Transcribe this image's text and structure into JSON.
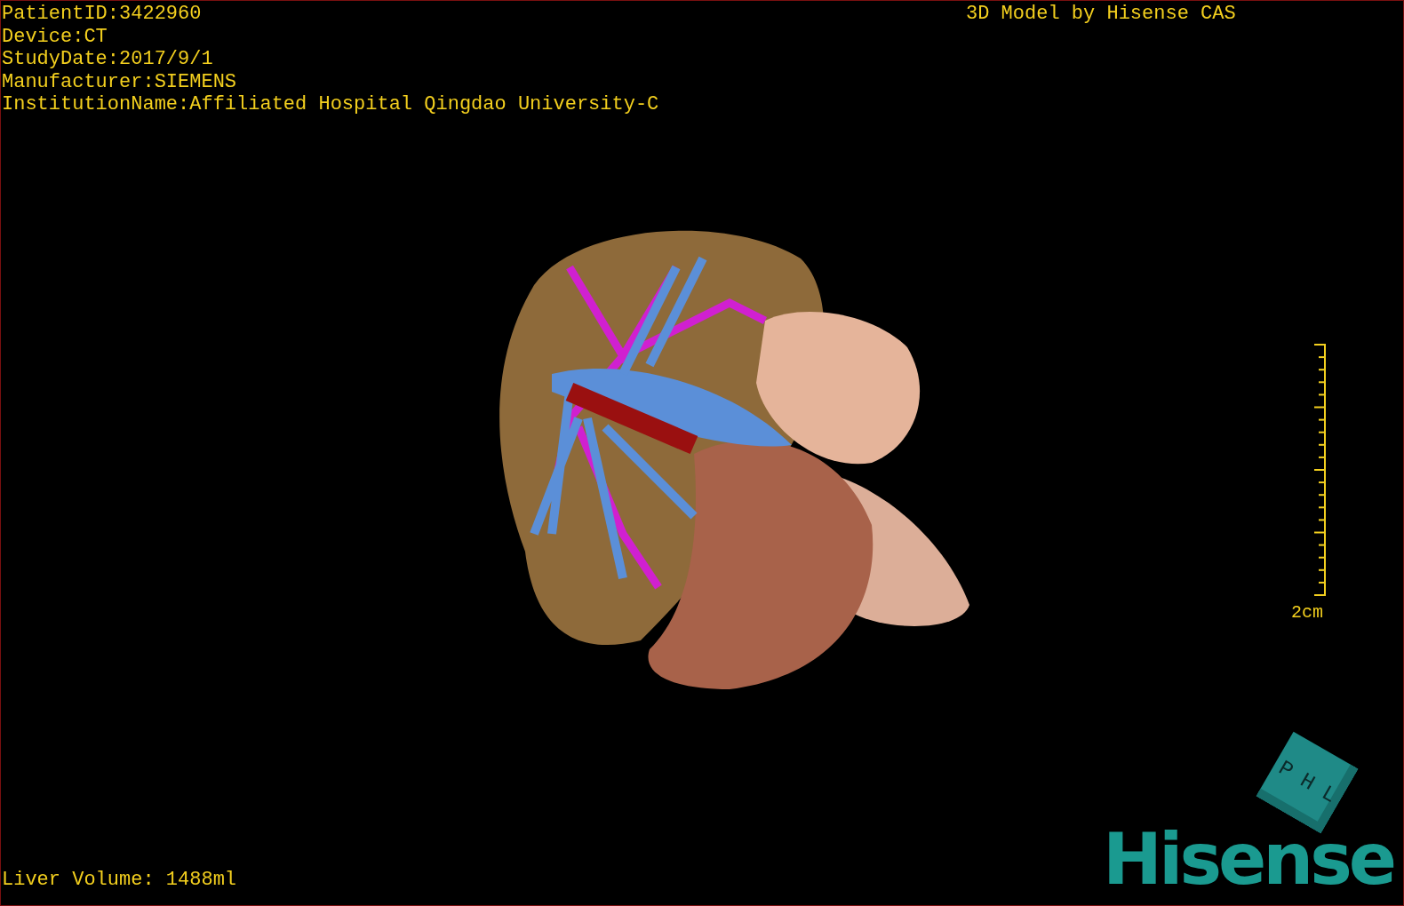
{
  "patient_info": [
    "PatientID:3422960",
    "Device:CT",
    "StudyDate:2017/9/1",
    "Manufacturer:SIEMENS",
    "InstitutionName:Affiliated Hospital Qingdao University-C"
  ],
  "title": "3D Model by Hisense CAS",
  "scale_bar": {
    "label": "2cm"
  },
  "orientation_cube": {
    "faces": [
      "P",
      "H",
      "L"
    ]
  },
  "liver_volume": "Liver Volume: 1488ml",
  "logo": "Hisense"
}
